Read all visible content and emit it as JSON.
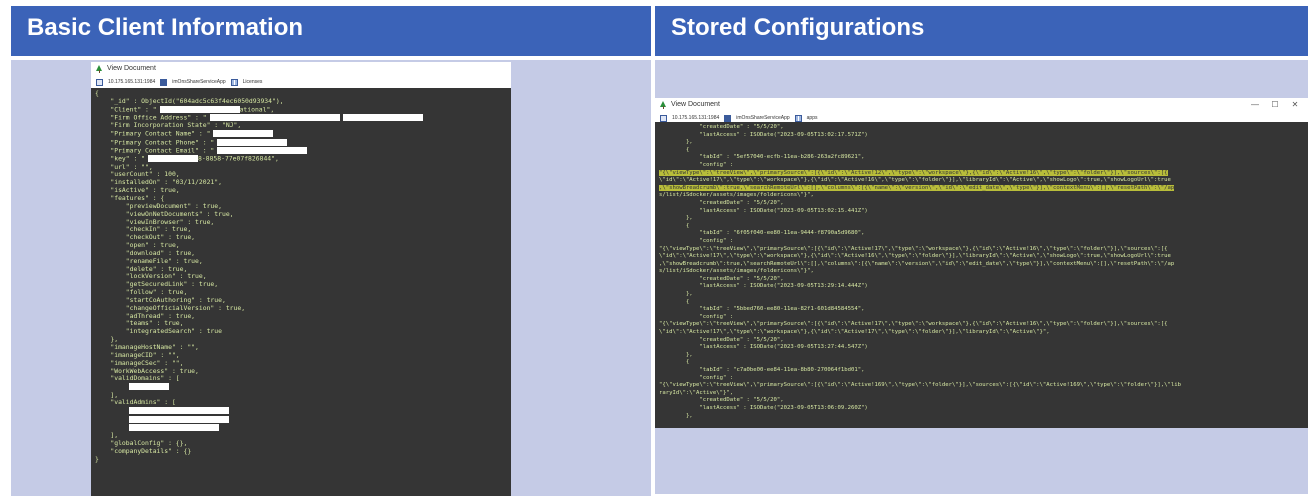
{
  "headers": {
    "left": "Basic Client Information",
    "right": "Stored Configurations"
  },
  "window": {
    "title": "View Document",
    "tab_server": "10.175.165.131:1984",
    "tab_db": "imOnsShareServiceApp",
    "tab_collection_left": "Licenses",
    "tab_collection_right": "apps",
    "controls": [
      "—",
      "☐",
      "✕"
    ]
  },
  "left_code": [
    "{",
    "    \"_id\" : ObjectId(\"604adc5c63f4ec6050d93934\"),",
    "    \"Client\" : \"",
    "    \"Firm Office Address\" : \"",
    "    \"Firm Incorporation State\" : \"NJ\",",
    "    \"Primary Contact Name\" : \"",
    "    \"Primary Contact Phone\" : \"",
    "    \"Primary Contact Email\" : \"",
    "    \"key\" : \"",
    "    \"url\" : \"\",",
    "    \"userCount\" : 100,",
    "    \"installedOn\" : \"03/11/2021\",",
    "    \"isActive\" : true,",
    "    \"features\" : {",
    "        \"previewDocument\" : true,",
    "        \"viewOnNetDocuments\" : true,",
    "        \"viewInBrowser\" : true,",
    "        \"checkIn\" : true,",
    "        \"checkOut\" : true,",
    "        \"open\" : true,",
    "        \"download\" : true,",
    "        \"renameFile\" : true,",
    "        \"delete\" : true,",
    "        \"lockVersion\" : true,",
    "        \"getSecuredLink\" : true,",
    "        \"follow\" : true,",
    "        \"startCoAuthoring\" : true,",
    "        \"changeOfficialVersion\" : true,",
    "        \"adThread\" : true,",
    "        \"teams\" : true,",
    "        \"integratedSearch\" : true",
    "    },",
    "    \"imanageHostName\" : \"\",",
    "    \"imanageCID\" : \"\",",
    "    \"imanageCSec\" : \"\",",
    "    \"WorkWebAccess\" : true,",
    "    \"validDomains\" : [",
    "        ",
    "    ],",
    "    \"validAdmins\" : [",
    "        ",
    "        ",
    "        ",
    "    ],",
    "    \"globalConfig\" : {},",
    "    \"companyDetails\" : {}",
    "}"
  ],
  "left_snippets": {
    "client_suffix": "ational\",",
    "key_suffix": "8-8858-77e07f826844\","
  },
  "right_code": [
    "            \"createdDate\" : \"5/5/20\",",
    "            \"lastAccess\" : ISODate(\"2023-09-05T13:02:17.571Z\")",
    "        },",
    "        {",
    "            \"tabId\" : \"5ef57040-ecfb-11ea-b286-263a2fc89621\",",
    "            \"config\" :",
    "\"{\\\"viewType\\\":\\\"treeView\\\",\\\"primarySource\\\":[{\\\"id\\\":\\\"Active!12\\\",\\\"type\\\":\\\"workspace\\\"},{\\\"id\\\":\\\"Active!16\\\",\\\"type\\\":\\\"folder\\\"}],\\\"sources\\\":[{",
    "\\\"id\\\":\\\"Active!17\\\",\\\"type\\\":\\\"workspace\\\"},{\\\"id\\\":\\\"Active!16\\\",\\\"type\\\":\\\"folder\\\"}],\\\"libraryId\\\":\\\"Active\\\",\\\"showLogo\\\":true,\\\"showLogoUrl\\\":true",
    ",\\\"showBreadcrumb\\\":true,\\\"searchRemoteUrl\\\":[],\\\"columns\\\":[{\\\"name\\\":\\\"version\\\",\\\"id\\\":\\\"edit_date\\\",\\\"type\\\"}],\\\"contextMenu\\\":[],\\\"resetPath\\\":\\\"/ap",
    "s/list/iSdocker/assets/images/foldericons\\\"}\",",
    "            \"createdDate\" : \"5/5/20\",",
    "            \"lastAccess\" : ISODate(\"2023-09-05T13:02:15.441Z\")",
    "        },",
    "        {",
    "            \"tabId\" : \"6f05f040-ee80-11ea-9444-f8790a5d9680\",",
    "            \"config\" :",
    "\"{\\\"viewType\\\":\\\"treeView\\\",\\\"primarySource\\\":[{\\\"id\\\":\\\"Active!17\\\",\\\"type\\\":\\\"workspace\\\"},{\\\"id\\\":\\\"Active!16\\\",\\\"type\\\":\\\"folder\\\"}],\\\"sources\\\":[{",
    "\\\"id\\\":\\\"Active!17\\\",\\\"type\\\":\\\"workspace\\\"},{\\\"id\\\":\\\"Active!16\\\",\\\"type\\\":\\\"folder\\\"}],\\\"libraryId\\\":\\\"Active\\\",\\\"showLogo\\\":true,\\\"showLogoUrl\\\":true",
    ",\\\"showBreadcrumb\\\":true,\\\"searchRemoteUrl\\\":[],\\\"columns\\\":[{\\\"name\\\":\\\"version\\\",\\\"id\\\":\\\"edit_date\\\",\\\"type\\\"}],\\\"contextMenu\\\":[],\\\"resetPath\\\":\\\"/ap",
    "s/list/iSdocker/assets/images/foldericons\\\"}\",",
    "            \"createdDate\" : \"5/5/20\",",
    "            \"lastAccess\" : ISODate(\"2023-09-05T13:29:14.444Z\")",
    "        },",
    "        {",
    "            \"tabId\" : \"5bbed760-ee80-11ea-82f1-601d84584554\",",
    "            \"config\" :",
    "\"{\\\"viewType\\\":\\\"treeView\\\",\\\"primarySource\\\":[{\\\"id\\\":\\\"Active!17\\\",\\\"type\\\":\\\"workspace\\\"},{\\\"id\\\":\\\"Active!16\\\",\\\"type\\\":\\\"folder\\\"}],\\\"sources\\\":[{",
    "\\\"id\\\":\\\"Active!17\\\",\\\"type\\\":\\\"workspace\\\"},{\\\"id\\\":\\\"Active!17\\\",\\\"type\\\":\\\"folder\\\"}],\\\"libraryId\\\":\\\"Active\\\"}\",",
    "            \"createdDate\" : \"5/5/20\",",
    "            \"lastAccess\" : ISODate(\"2023-09-05T13:27:44.547Z\")",
    "        },",
    "        {",
    "            \"tabId\" : \"c7a0be00-ee84-11ea-8b80-270064f1bd01\",",
    "            \"config\" :",
    "\"{\\\"viewType\\\":\\\"treeView\\\",\\\"primarySource\\\":[{\\\"id\\\":\\\"Active!169\\\",\\\"type\\\":\\\"folder\\\"}],\\\"sources\\\":[{\\\"id\\\":\\\"Active!169\\\",\\\"type\\\":\\\"folder\\\"}],\\\"lib",
    "raryId\\\":\\\"Active\\\"}\",",
    "            \"createdDate\" : \"5/5/20\",",
    "            \"lastAccess\" : ISODate(\"2023-09-05T13:06:09.260Z\")",
    "        },"
  ],
  "colors": {
    "header_bg": "#3b63b8",
    "panel_bg": "#c5cbe6",
    "code_bg": "#353535",
    "code_text": "#d7e8a3",
    "highlight": "#b8bd3a"
  }
}
